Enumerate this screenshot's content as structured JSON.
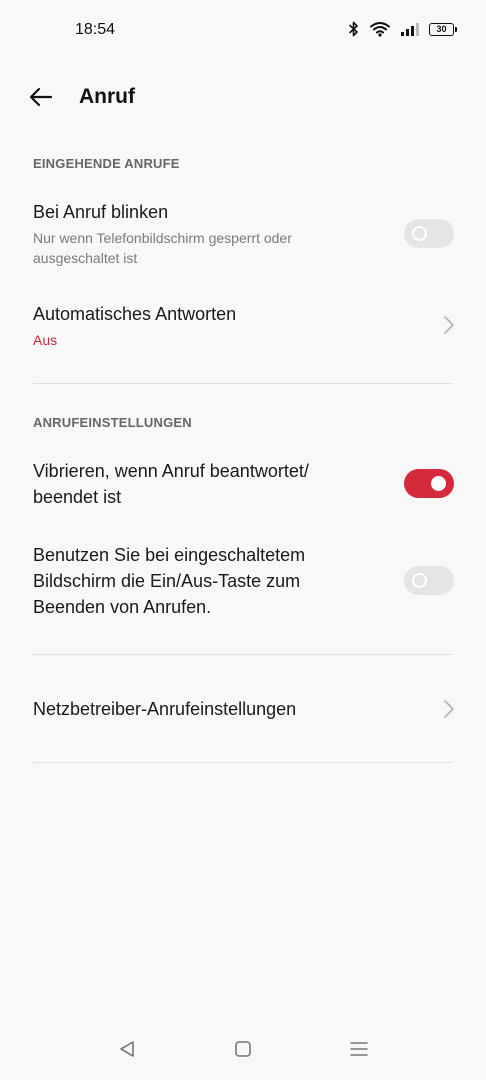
{
  "status_bar": {
    "time": "18:54",
    "battery_level": "30",
    "icons": [
      "bluetooth-icon",
      "wifi-icon",
      "signal-icon",
      "battery-icon"
    ]
  },
  "header": {
    "title": "Anruf",
    "back_icon": "arrow-left-icon"
  },
  "sections": {
    "incoming": {
      "header": "EINGEHENDE ANRUFE",
      "flash": {
        "title": "Bei Anruf blinken",
        "subtitle": "Nur wenn Telefonbildschirm gesperrt oder ausgeschaltet ist",
        "enabled": false
      },
      "auto_answer": {
        "title": "Automatisches Antworten",
        "value": "Aus"
      }
    },
    "call_settings": {
      "header": "ANRUFEINSTELLUNGEN",
      "vibrate": {
        "title": "Vibrieren, wenn Anruf beantwortet/ beendet ist",
        "enabled": true
      },
      "power_end": {
        "title": "Benutzen Sie bei eingeschaltetem Bildschirm die Ein/Aus-Taste zum Beenden von Anrufen.",
        "enabled": false
      }
    },
    "carrier": {
      "title": "Netzbetreiber-Anrufeinstellungen"
    }
  },
  "colors": {
    "accent": "#d42a3c",
    "value_red": "#c4293b",
    "background": "#f8f8f8"
  },
  "nav_bar": {
    "icons": [
      "back-triangle-icon",
      "home-square-icon",
      "menu-lines-icon"
    ]
  }
}
